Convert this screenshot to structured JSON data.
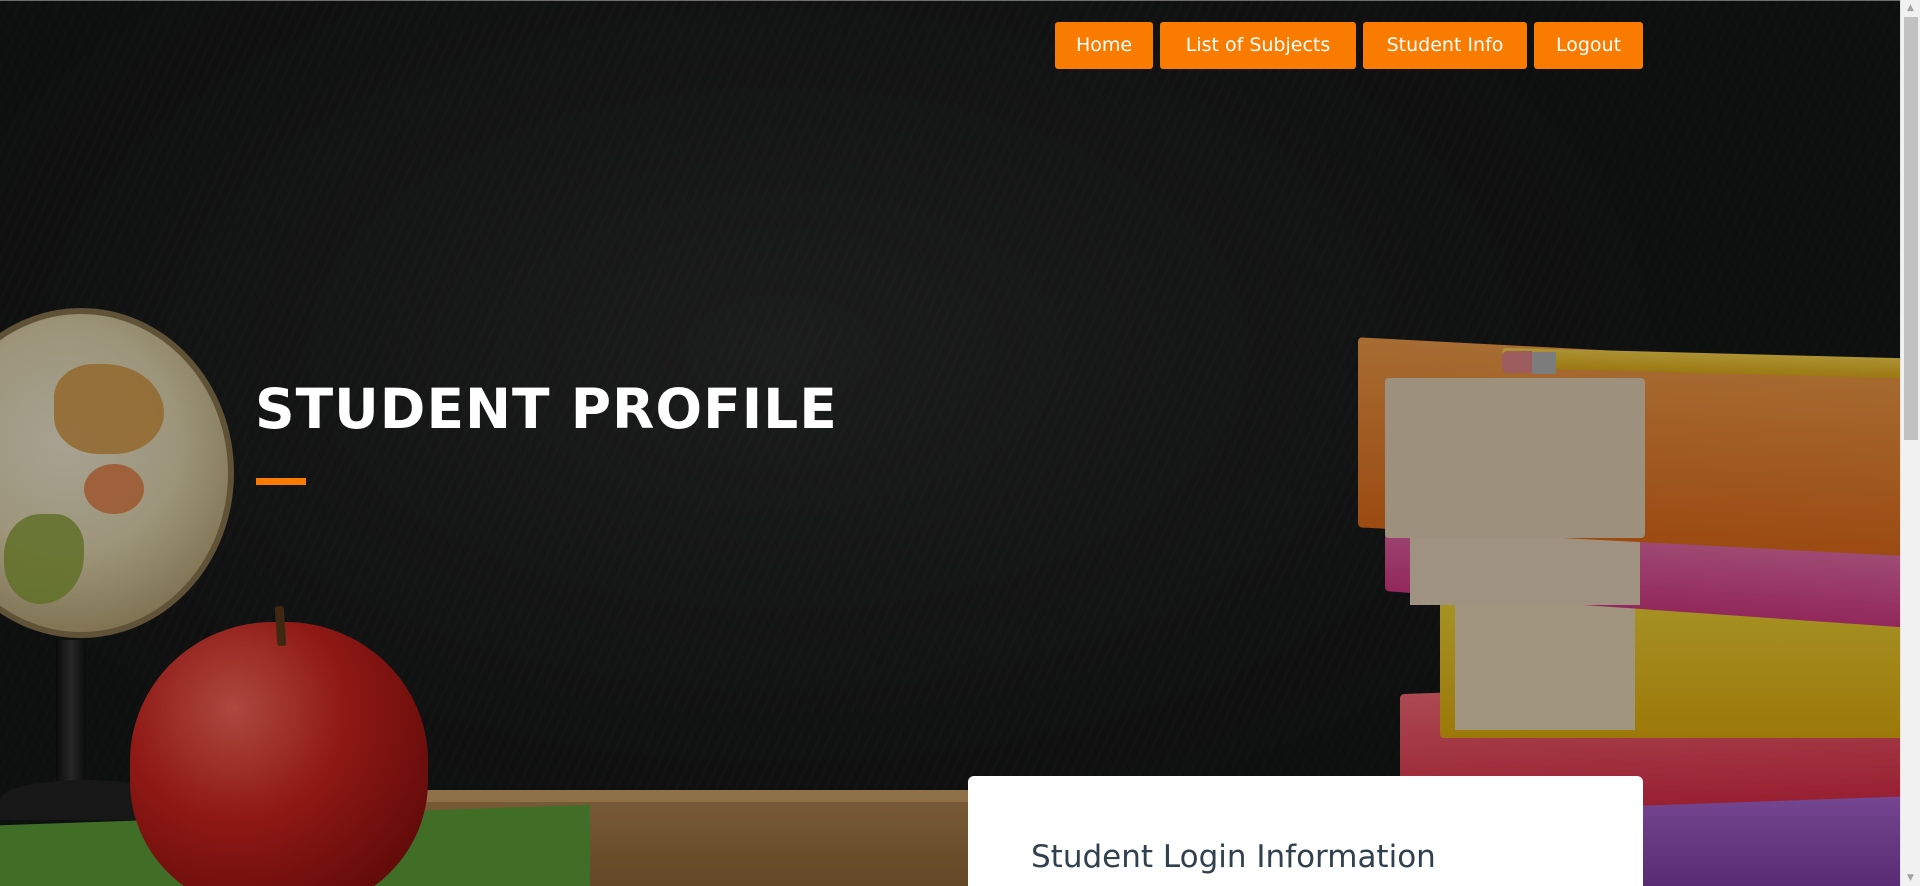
{
  "nav": {
    "items": [
      {
        "label": "Home"
      },
      {
        "label": "List of Subjects"
      },
      {
        "label": "Student Info"
      },
      {
        "label": "Logout"
      }
    ]
  },
  "hero": {
    "title": "STUDENT PROFILE"
  },
  "card": {
    "title": "Student Login Information"
  },
  "colors": {
    "accent": "#f97b00",
    "background": "#1e1f1f",
    "card": "#ffffff",
    "card_title": "#30404f"
  },
  "icons": {
    "scroll_up": "triangle-up-icon",
    "scroll_down": "triangle-down-icon"
  }
}
